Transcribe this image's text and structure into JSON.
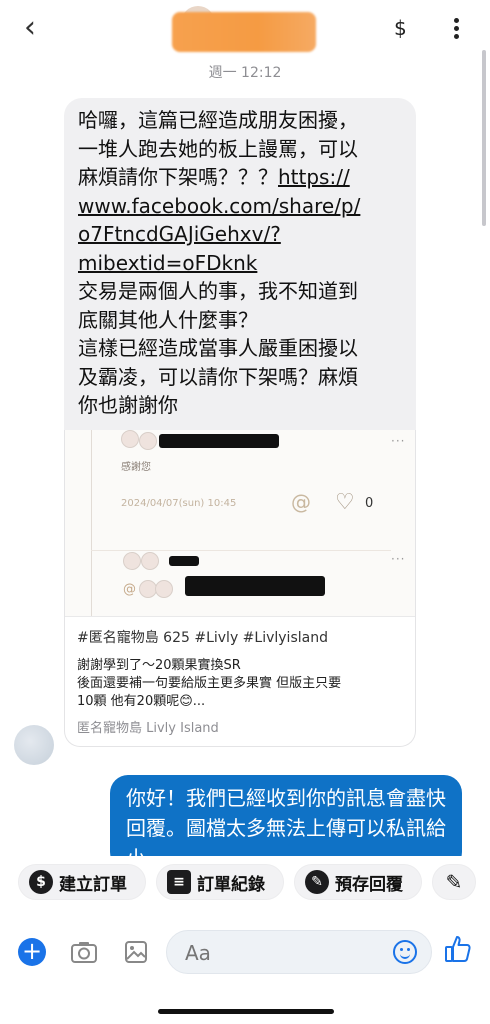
{
  "header": {
    "back_icon": "chevron-left-icon",
    "dollar_label": "$",
    "timestamp": "週一 12:12"
  },
  "incoming": {
    "text_lines": [
      "哈囉，這篇已經造成朋友困擾，",
      "一堆人跑去她的板上謾罵，可以",
      "麻煩請你下架嗎？？？"
    ],
    "link_parts": [
      "https://",
      "www.facebook.com/share/p/",
      "o7FtncdGAJiGehxv/?",
      "mibextid=oFDknk"
    ],
    "after_lines": [
      "交易是兩個人的事，我不知道到",
      "底關其他人什麼事？",
      "這樣已經造成當事人嚴重困擾以",
      "及霸凌，可以請你下架嗎？麻煩",
      "你也謝謝你"
    ],
    "card": {
      "preview": {
        "thanks": "感謝您",
        "date": "2024/04/07(sun) 10:45",
        "like_count": "0"
      },
      "title": "#匿名寵物島 625 #Livly #Livlyisland",
      "desc_line1": "謝謝學到了～20顆果實換SR",
      "desc_line2": "後面還要補一句要給版主更多果實  但版主只要",
      "desc_line3": "10顆 他有20顆呢😊...",
      "source": "匿名寵物島 Livly Island"
    }
  },
  "outgoing": {
    "text": "你好！我們已經收到你的訊息會盡快回覆。圖檔太多無法上傳可以私訊給小"
  },
  "actions": [
    {
      "icon": "dollar-circle-icon",
      "label": "建立訂單"
    },
    {
      "icon": "order-list-icon",
      "label": "訂單紀錄"
    },
    {
      "icon": "chat-bubbles-icon",
      "label": "預存回覆"
    }
  ],
  "composer": {
    "placeholder": "Aa"
  }
}
